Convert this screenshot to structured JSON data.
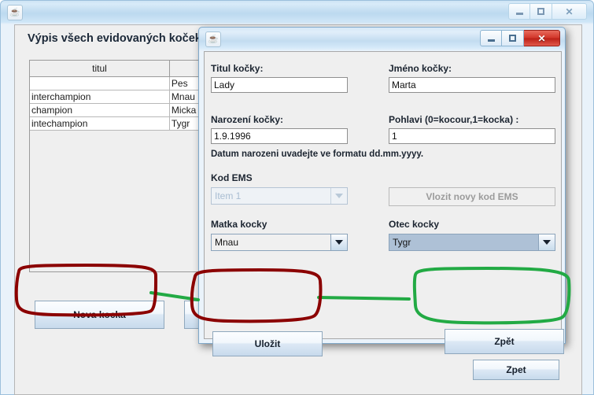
{
  "main_window": {
    "icon": "java-coffee-icon",
    "title_bar_buttons": {
      "minimize": "minimize-icon",
      "maximize": "maximize-icon",
      "close": "close-icon"
    },
    "heading": "Výpis všech evidovaných koček",
    "table": {
      "headers": [
        "titul",
        "",
        ""
      ],
      "rows": [
        [
          "",
          "Pes",
          ""
        ],
        [
          "interchampion",
          "Mnau",
          ""
        ],
        [
          "champion",
          "Micka",
          ""
        ],
        [
          "intechampion",
          "Tygr",
          ""
        ]
      ]
    },
    "buttons": {
      "nova_kocka": "Nova kocka",
      "hidden_partial": "",
      "zpet": "Zpet"
    }
  },
  "dialog": {
    "icon": "java-coffee-icon",
    "title_bar_buttons": {
      "minimize": "minimize-icon",
      "maximize": "maximize-icon",
      "close": "close-icon"
    },
    "fields": {
      "titul_label": "Titul kočky:",
      "titul_value": "Lady",
      "jmeno_label": "Jméno kočky:",
      "jmeno_value": "Marta",
      "narozeni_label": "Narození kočky:",
      "narozeni_value": "1.9.1996",
      "pohlavi_label": "Pohlavi (0=kocour,1=kocka) :",
      "pohlavi_value": "1",
      "date_note": "Datum narozeni uvadejte ve formatu dd.mm.yyyy.",
      "kod_ems_label": "Kod EMS",
      "kod_ems_value": "Item 1",
      "vlozit_ems_button": "Vlozit novy kod EMS",
      "matka_label": "Matka kocky",
      "matka_value": "Mnau",
      "otec_label": "Otec kocky",
      "otec_value": "Tygr"
    },
    "buttons": {
      "ulozit": "Uložit",
      "zpet": "Zpět"
    }
  },
  "annotations": {
    "dark_red_color": "#8b0000",
    "green_color": "#22aa44",
    "shapes": [
      {
        "name": "red-oval-nova-kocka",
        "color": "#8b0000"
      },
      {
        "name": "red-oval-ulozit",
        "color": "#8b0000"
      },
      {
        "name": "green-oval-zpet",
        "color": "#22aa44"
      },
      {
        "name": "green-line-nova-to-ulozit",
        "color": "#22aa44"
      },
      {
        "name": "green-line-ulozit-to-zpet",
        "color": "#22aa44"
      }
    ]
  },
  "colors": {
    "panel_bg": "#efefef",
    "aero_frame": "#cfe4f4",
    "button_accent": "#c7daec",
    "focused_combo": "#aec1d6"
  }
}
